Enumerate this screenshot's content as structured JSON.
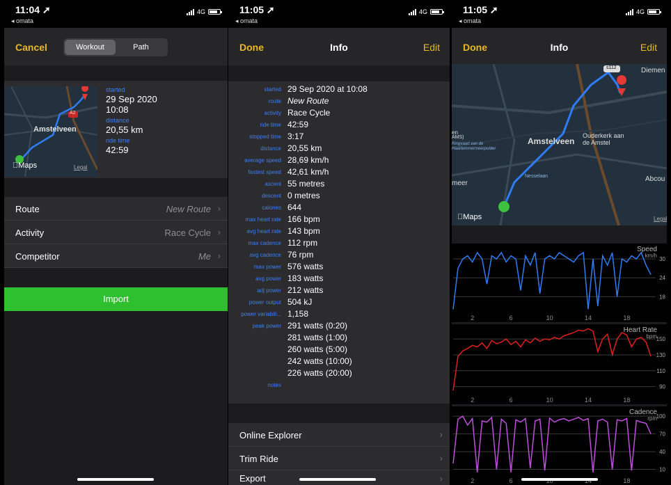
{
  "panel1": {
    "status": {
      "time": "11:04 ➚",
      "back": "◂ omata",
      "network": "4G"
    },
    "nav": {
      "cancel": "Cancel",
      "segments": [
        "Workout",
        "Path"
      ]
    },
    "map": {
      "town": "Amstelveen",
      "maps": "Maps",
      "legal": "Legal",
      "road": "A2"
    },
    "summary": {
      "started_label": "started",
      "started_date": "29 Sep 2020",
      "started_time": "10:08",
      "distance_label": "distance",
      "distance": "20,55 km",
      "ride_label": "ride time",
      "ride_time": "42:59"
    },
    "rows": [
      {
        "label": "Route",
        "value": "New Route"
      },
      {
        "label": "Activity",
        "value": "Race Cycle"
      },
      {
        "label": "Competitor",
        "value": "Me"
      }
    ],
    "import": "Import"
  },
  "panel2": {
    "status": {
      "time": "11:05 ➚",
      "back": "◂ omata",
      "network": "4G"
    },
    "nav": {
      "done": "Done",
      "title": "Info",
      "edit": "Edit"
    },
    "info": [
      {
        "k": "started",
        "v": "29 Sep 2020 at 10:08"
      },
      {
        "k": "route",
        "v": "New Route"
      },
      {
        "k": "activity",
        "v": "Race Cycle"
      },
      {
        "k": "ride time",
        "v": "42:59"
      },
      {
        "k": "stopped time",
        "v": "3:17"
      },
      {
        "k": "distance",
        "v": "20,55 km"
      },
      {
        "k": "average speed",
        "v": "28,69 km/h"
      },
      {
        "k": "fastest speed",
        "v": "42,61 km/h"
      },
      {
        "k": "ascent",
        "v": "55 metres"
      },
      {
        "k": "descent",
        "v": "0 metres"
      },
      {
        "k": "calories",
        "v": "644"
      },
      {
        "k": "max heart rate",
        "v": "166 bpm"
      },
      {
        "k": "avg heart rate",
        "v": "143 bpm"
      },
      {
        "k": "max cadence",
        "v": "112 rpm"
      },
      {
        "k": "avg cadence",
        "v": "76 rpm"
      },
      {
        "k": "max power",
        "v": "576 watts"
      },
      {
        "k": "avg power",
        "v": "183 watts"
      },
      {
        "k": "adj power",
        "v": "212 watts"
      },
      {
        "k": "power output",
        "v": "504 kJ"
      },
      {
        "k": "power variabili...",
        "v": "1,158"
      },
      {
        "k": "peak power",
        "v": "291 watts (0:20)"
      },
      {
        "k": "",
        "v": "281 watts (1:00)"
      },
      {
        "k": "",
        "v": "260 watts (5:00)"
      },
      {
        "k": "",
        "v": "242 watts (10:00)"
      },
      {
        "k": "",
        "v": "226 watts (20:00)"
      },
      {
        "k": "notes",
        "v": ""
      }
    ],
    "menu": [
      "Online Explorer",
      "Trim Ride",
      "Export"
    ]
  },
  "panel3": {
    "status": {
      "time": "11:05 ➚",
      "back": "◂ omata",
      "network": "4G"
    },
    "nav": {
      "done": "Done",
      "title": "Info",
      "edit": "Edit"
    },
    "map": {
      "town": "Amstelveen",
      "town2": "Ouderkerk aan de Amstel",
      "diemen": "Diemen",
      "meer": "meer",
      "abcou": "Abcou",
      "road": "s112",
      "street": "Nesselaan",
      "maps": "Maps",
      "legal": "Legal",
      "en": "en",
      "ams": "AMS)",
      "ringvaart": "Ringvaart van de Haarlemmermeerpolder"
    }
  },
  "chart_data": [
    {
      "type": "line",
      "title": "Speed",
      "unit": "km/h",
      "color": "#2f7cf6",
      "x_ticks": [
        2,
        6,
        10,
        14,
        18
      ],
      "y_ticks": [
        30,
        24,
        18
      ],
      "ylim": [
        13,
        34
      ],
      "x": [
        0,
        0.5,
        1,
        1.5,
        2,
        2.5,
        3,
        3.5,
        4,
        4.5,
        5,
        5.5,
        6,
        6.5,
        7,
        7.5,
        8,
        8.5,
        9,
        9.5,
        10,
        10.5,
        11,
        11.5,
        12,
        12.5,
        13,
        13.5,
        14,
        14.5,
        15,
        15.5,
        16,
        16.5,
        17,
        17.5,
        18,
        18.5,
        19,
        19.5,
        20,
        20.5
      ],
      "y": [
        14,
        27,
        30,
        31,
        29,
        32,
        30,
        22,
        31,
        30,
        32,
        29,
        31,
        30,
        20,
        31,
        28,
        32,
        19,
        30,
        31,
        30,
        32,
        31,
        30,
        29,
        31,
        32,
        14,
        30,
        15,
        31,
        28,
        32,
        18,
        30,
        29,
        31,
        30,
        32,
        28,
        25
      ]
    },
    {
      "type": "line",
      "title": "Heart Rate",
      "unit": "bpm",
      "color": "#e0201c",
      "x_ticks": [
        2,
        6,
        10,
        14,
        18
      ],
      "y_ticks": [
        150,
        130,
        110,
        90
      ],
      "ylim": [
        80,
        165
      ],
      "x": [
        0,
        0.5,
        1,
        1.5,
        2,
        2.5,
        3,
        3.5,
        4,
        4.5,
        5,
        5.5,
        6,
        6.5,
        7,
        7.5,
        8,
        8.5,
        9,
        9.5,
        10,
        10.5,
        11,
        11.5,
        12,
        12.5,
        13,
        13.5,
        14,
        14.5,
        15,
        15.5,
        16,
        16.5,
        17,
        17.5,
        18,
        18.5,
        19,
        19.5,
        20,
        20.5
      ],
      "y": [
        85,
        128,
        135,
        138,
        142,
        140,
        145,
        138,
        148,
        144,
        146,
        150,
        143,
        147,
        140,
        149,
        145,
        151,
        147,
        150,
        149,
        152,
        150,
        154,
        156,
        158,
        161,
        160,
        163,
        160,
        134,
        150,
        156,
        130,
        150,
        158,
        155,
        140,
        150,
        152,
        146,
        128
      ]
    },
    {
      "type": "line",
      "title": "Cadence",
      "unit": "rpm",
      "color": "#c04fe0",
      "x_ticks": [
        2,
        6,
        10,
        14,
        18
      ],
      "y_ticks": [
        100,
        70,
        40,
        10
      ],
      "ylim": [
        0,
        112
      ],
      "x": [
        0,
        0.5,
        1,
        1.5,
        2,
        2.5,
        3,
        3.5,
        4,
        4.5,
        5,
        5.5,
        6,
        6.5,
        7,
        7.5,
        8,
        8.5,
        9,
        9.5,
        10,
        10.5,
        11,
        11.5,
        12,
        12.5,
        13,
        13.5,
        14,
        14.5,
        15,
        15.5,
        16,
        16.5,
        17,
        17.5,
        18,
        18.5,
        19,
        19.5,
        20,
        20.5
      ],
      "y": [
        20,
        95,
        100,
        85,
        96,
        5,
        92,
        90,
        98,
        10,
        95,
        88,
        5,
        94,
        90,
        96,
        12,
        92,
        95,
        8,
        97,
        90,
        94,
        96,
        92,
        95,
        98,
        93,
        96,
        5,
        92,
        95,
        90,
        10,
        94,
        92,
        96,
        8,
        93,
        90,
        88,
        70
      ]
    }
  ]
}
